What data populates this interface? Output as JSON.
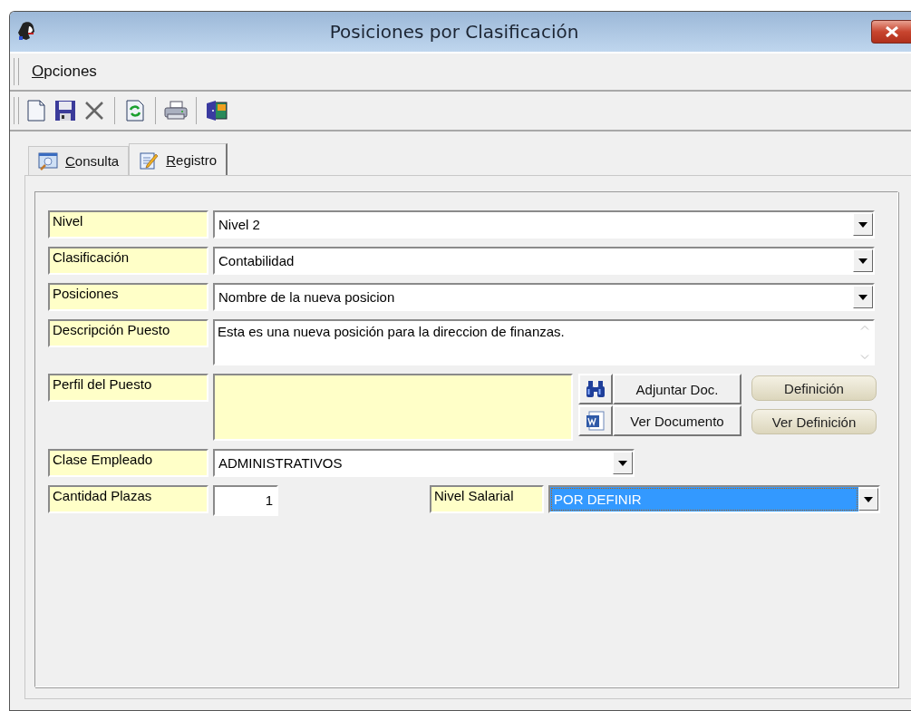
{
  "window": {
    "title": "Posiciones por Clasificación"
  },
  "menu": [
    {
      "label": "Opciones"
    }
  ],
  "tabs": [
    {
      "label": "Consulta",
      "selected": false
    },
    {
      "label": "Registro",
      "selected": true
    }
  ],
  "form": {
    "rows": [
      {
        "kind": "combo",
        "label": "Nivel",
        "value": "Nivel 2"
      },
      {
        "kind": "combo",
        "label": "Clasificación",
        "value": "Contabilidad"
      },
      {
        "kind": "combo",
        "label": "Posiciones",
        "value": "Nombre de la nueva posicion"
      },
      {
        "kind": "memo",
        "label": "Descripción Puesto",
        "value": "Esta es una nueva posición para la direccion de finanzas."
      },
      {
        "kind": "profile",
        "label": "Perfil del Puesto",
        "doc_buttons": [
          "Adjuntar Doc.",
          "Ver Documento"
        ],
        "definition_buttons": [
          "Definición",
          "Ver Definición"
        ]
      },
      {
        "kind": "short_combo",
        "label": "Clase Empleado",
        "value": "ADMINISTRATIVOS"
      },
      {
        "kind": "pair",
        "label": "Cantidad Plazas",
        "value": "1",
        "second_label": "Nivel Salarial",
        "second_value": "POR DEFINIR",
        "second_selected": true
      }
    ]
  }
}
